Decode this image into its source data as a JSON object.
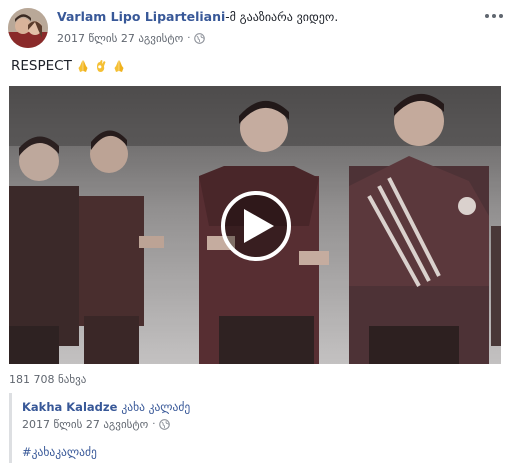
{
  "post": {
    "author_name": "Varlam Lipo Liparteliani",
    "action": "-მ გააზიარა ვიდეო.",
    "timestamp": "2017 წლის 27 აგვისტო",
    "privacy_icon": "globe-icon",
    "more_icon": "more-horizontal-icon",
    "text": "RESPECT",
    "emojis": [
      "folded-hands",
      "ok-hand",
      "folded-hands"
    ]
  },
  "video": {
    "play_icon": "play-icon",
    "views": "181 708 ნახვა"
  },
  "shared": {
    "author_name": "Kakha Kaladze",
    "author_name_geo": "კახა კალაძე",
    "timestamp": "2017 წლის 27 აგვისტო",
    "privacy_icon": "globe-icon",
    "hashtag": "#კახაკალაძე"
  },
  "colors": {
    "link": "#385898",
    "meta": "#616770",
    "text": "#1d2129",
    "border": "#dddfe2"
  }
}
